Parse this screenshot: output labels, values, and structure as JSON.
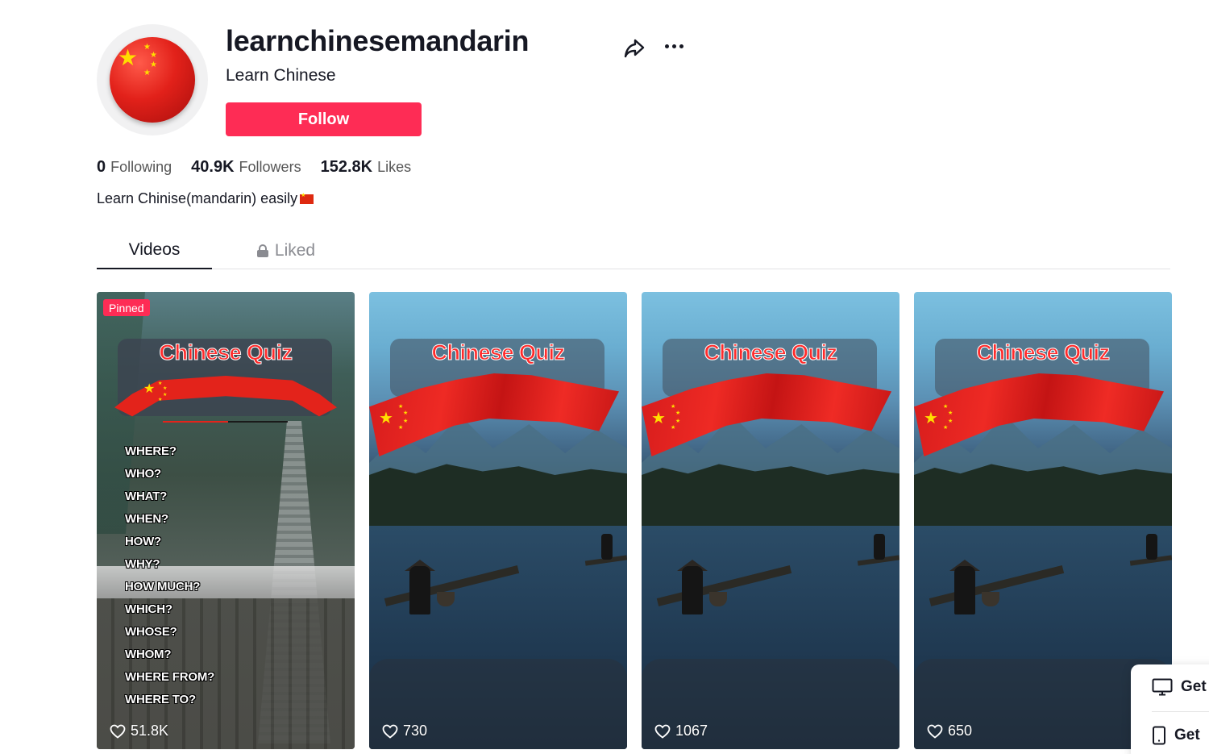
{
  "profile": {
    "username": "learnchinesemandarin",
    "nickname": "Learn Chinese",
    "follow_label": "Follow",
    "avatar_icon": "china-flag-ball-icon",
    "bio": "Learn Chinise(mandarin) easily"
  },
  "stats": {
    "following_count": "0",
    "following_label": "Following",
    "followers_count": "40.9K",
    "followers_label": "Followers",
    "likes_count": "152.8K",
    "likes_label": "Likes"
  },
  "tabs": {
    "videos": "Videos",
    "liked": "Liked"
  },
  "videos": [
    {
      "pinned_label": "Pinned",
      "title": "Chinese Quiz",
      "likes": "51.8K",
      "progress": 0.52,
      "words": [
        "WHERE?",
        "WHO?",
        "WHAT?",
        "WHEN?",
        "HOW?",
        "WHY?",
        "HOW MUCH?",
        "WHICH?",
        "WHOSE?",
        "WHOM?",
        "WHERE FROM?",
        "WHERE TO?"
      ]
    },
    {
      "title": "Chinese Quiz",
      "likes": "730"
    },
    {
      "title": "Chinese Quiz",
      "likes": "1067"
    },
    {
      "title": "Chinese Quiz",
      "likes": "650"
    }
  ],
  "get_app": {
    "desktop_label": "Get",
    "mobile_label": "Get"
  },
  "colors": {
    "accent": "#fe2c55",
    "flag_red": "#de2910",
    "flag_yellow": "#ffde00",
    "text": "#161823",
    "muted": "#8a8b91"
  }
}
